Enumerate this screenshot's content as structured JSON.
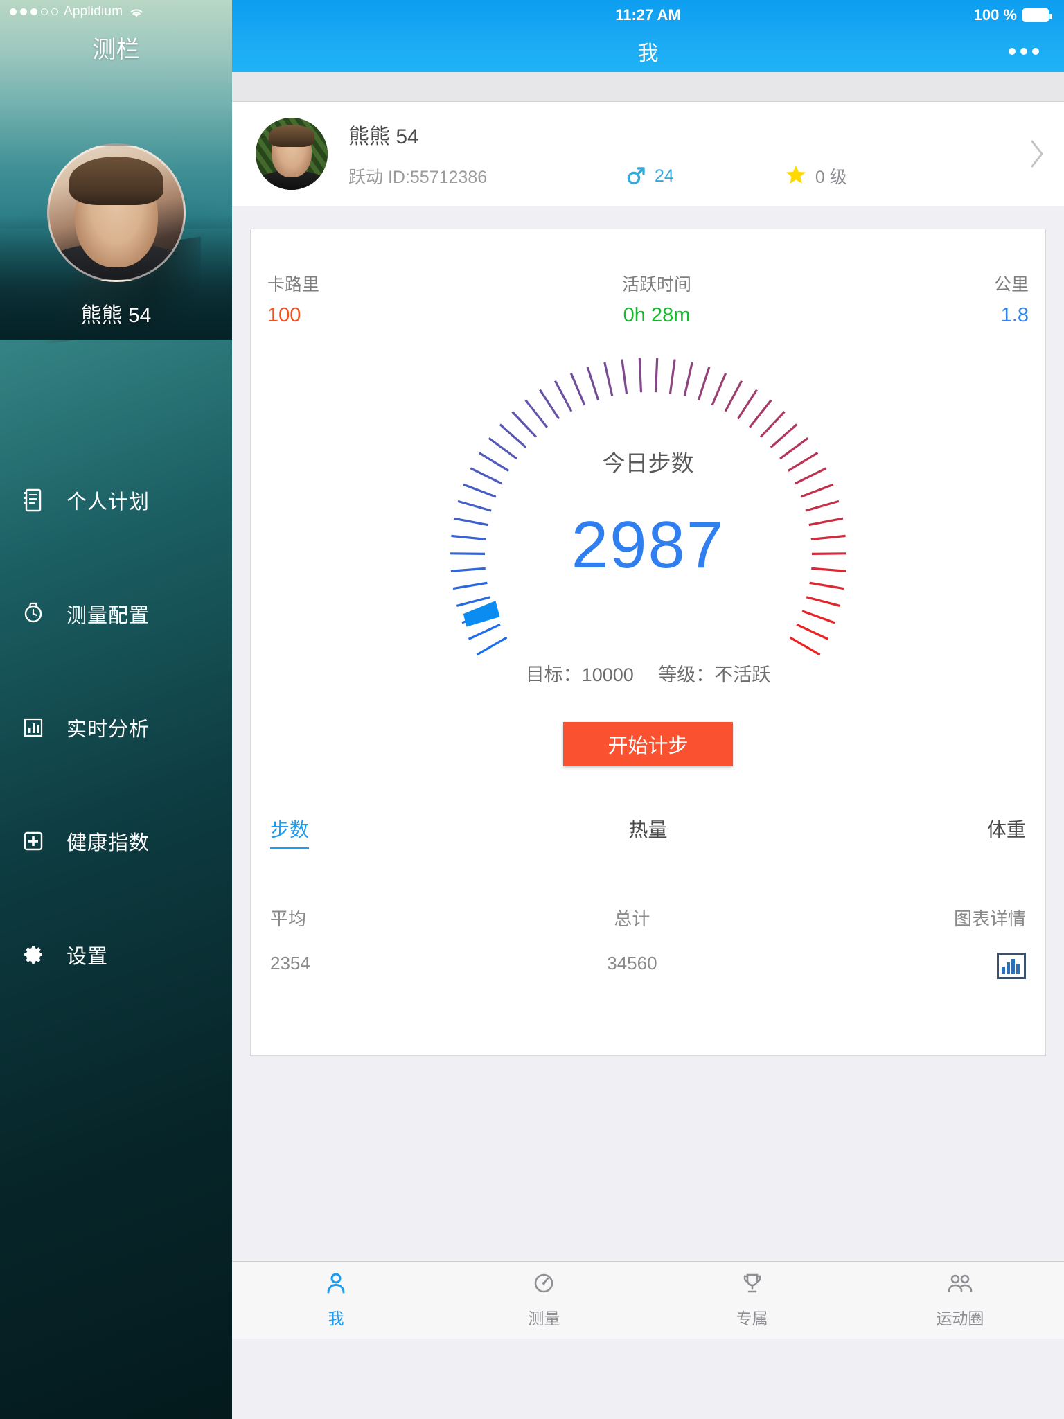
{
  "sidebar": {
    "status": {
      "carrier": "Applidium",
      "signal_dots": 5,
      "signal_filled": 3,
      "wifi_icon": "wifi-icon"
    },
    "title": "测栏",
    "user_name": "熊熊 54",
    "items": [
      {
        "label": "个人计划",
        "icon": "notebook-icon"
      },
      {
        "label": "测量配置",
        "icon": "watch-icon"
      },
      {
        "label": "实时分析",
        "icon": "bar-chart-icon"
      },
      {
        "label": "健康指数",
        "icon": "medical-cross-icon"
      },
      {
        "label": "设置",
        "icon": "gear-icon"
      }
    ]
  },
  "phone": {
    "status": {
      "time": "11:27 AM",
      "battery_percent": "100 %"
    },
    "nav": {
      "title": "我",
      "more_icon": "ellipsis-icon"
    },
    "profile": {
      "avatar_icon": "user-avatar",
      "name": "熊熊 54",
      "id_label": "跃动 ID:55712386",
      "gender_icon": "male-icon",
      "age": "24",
      "level_icon": "star-icon",
      "level": "0 级",
      "chevron_icon": "chevron-right-icon"
    },
    "stats": [
      {
        "label": "卡路里",
        "value": "100",
        "color": "#f4511e"
      },
      {
        "label": "活跃时间",
        "value": "0h 28m",
        "color": "#18b92e"
      },
      {
        "label": "公里",
        "value": "1.8",
        "color": "#2f86f0"
      }
    ],
    "gauge": {
      "title": "今日步数",
      "steps": "2987",
      "goal_label": "目标：10000",
      "level_label": "等级：不活跃",
      "start_button": "开始计步"
    },
    "tabs": [
      {
        "label": "步数",
        "active": true
      },
      {
        "label": "热量",
        "active": false
      },
      {
        "label": "体重",
        "active": false
      }
    ],
    "summary": {
      "avg_label": "平均",
      "avg_value": "2354",
      "total_label": "总计",
      "total_value": "34560",
      "detail_label": "图表详情",
      "detail_icon": "chart-detail-icon"
    },
    "tabbar": [
      {
        "label": "我",
        "icon": "person-icon",
        "active": true
      },
      {
        "label": "测量",
        "icon": "gauge-icon",
        "active": false
      },
      {
        "label": "专属",
        "icon": "trophy-icon",
        "active": false
      },
      {
        "label": "运动圈",
        "icon": "people-icon",
        "active": false
      }
    ]
  },
  "chart_data": {
    "type": "gauge",
    "title": "今日步数",
    "value": 2987,
    "goal": 10000,
    "unit": "steps",
    "ticks_total": 48,
    "ticks_filled": 2,
    "start_angle_deg": -210,
    "end_angle_deg": 30,
    "color_start": "#1a6ef0",
    "color_end": "#ef2020",
    "pointer_position_ticks": 2,
    "annotations": [
      "目标：10000",
      "等级：不活跃"
    ],
    "related_metrics": [
      {
        "name": "卡路里",
        "value": 100
      },
      {
        "name": "活跃时间",
        "value": "0h 28m"
      },
      {
        "name": "公里",
        "value": 1.8
      }
    ],
    "series_summary": {
      "平均": 2354,
      "总计": 34560
    }
  }
}
